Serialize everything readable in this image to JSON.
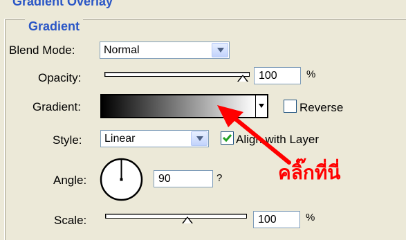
{
  "panel": {
    "top_title": "Gradient Overlay",
    "group_title": "Gradient"
  },
  "blend_mode": {
    "label": "Blend Mode:",
    "value": "Normal"
  },
  "opacity": {
    "label": "Opacity:",
    "value": "100",
    "unit": "%",
    "level": 100
  },
  "gradient": {
    "label": "Gradient:",
    "colors": [
      "#000000",
      "#ffffff"
    ],
    "reverse_label": "Reverse",
    "reverse_checked": false
  },
  "style": {
    "label": "Style:",
    "value": "Linear",
    "align_label": "Align with Layer",
    "align_checked": true
  },
  "angle": {
    "label": "Angle:",
    "value": "90",
    "unit": "?"
  },
  "scale": {
    "label": "Scale:",
    "value": "100",
    "unit": "%",
    "level": 100
  },
  "annotation": {
    "text": "คลิ๊กที่นี่",
    "color": "#ff0000"
  }
}
